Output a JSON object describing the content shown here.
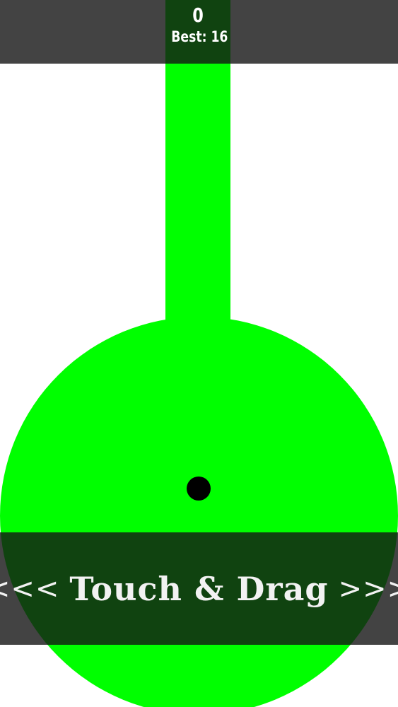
{
  "game": {
    "score": "0",
    "best": "Best: 16",
    "colors": {
      "track": "#00ff00",
      "ball": "#000000",
      "overlay": "#141414",
      "text": "#ffffff"
    }
  },
  "instruction": {
    "left_arrows": "<<<",
    "label": "Touch & Drag",
    "right_arrows": ">>>"
  }
}
